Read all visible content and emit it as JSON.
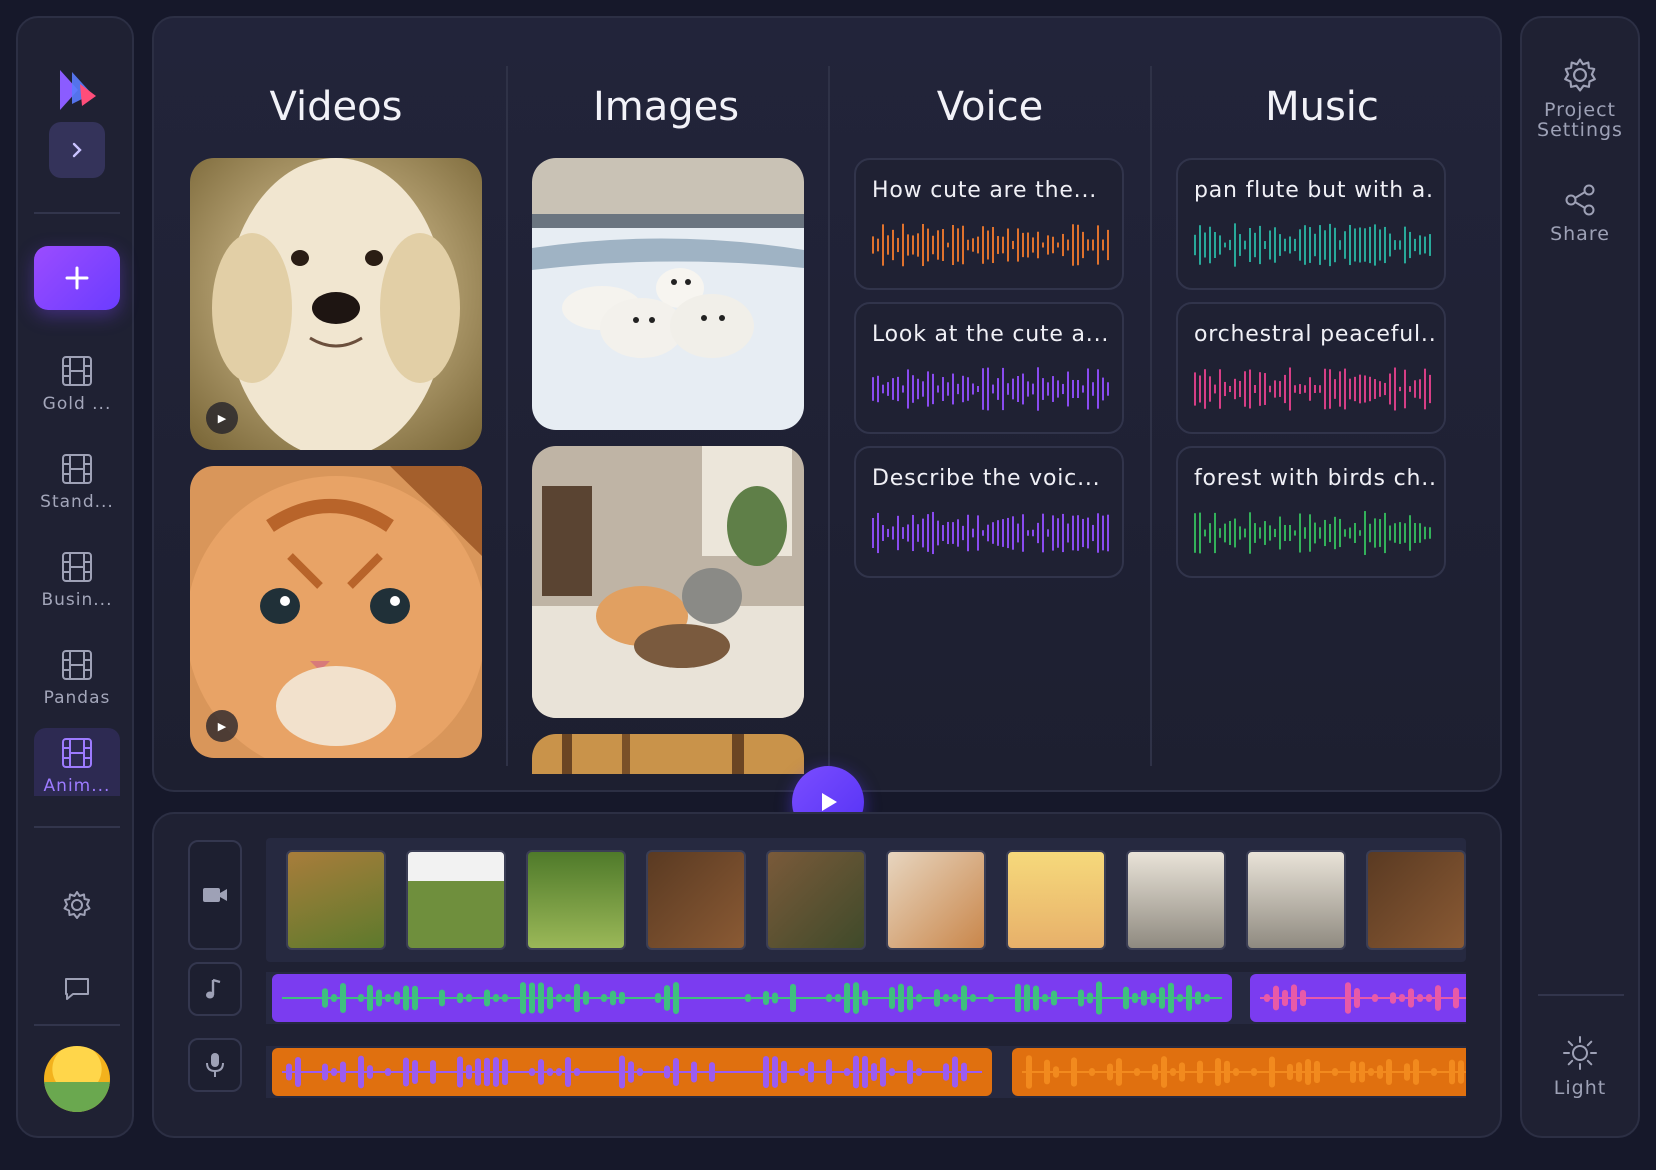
{
  "sidebar": {
    "expand_icon": "chevron-right-icon",
    "new_label": "+",
    "projects": [
      {
        "label": "Gold ..."
      },
      {
        "label": "Stand..."
      },
      {
        "label": "Busin..."
      },
      {
        "label": "Pandas"
      },
      {
        "label": "Anim..."
      }
    ],
    "settings_icon": "gear-icon",
    "feedback_icon": "chat-bubble-icon"
  },
  "library": {
    "columns": [
      {
        "title": "Videos"
      },
      {
        "title": "Images"
      },
      {
        "title": "Voice"
      },
      {
        "title": "Music"
      }
    ],
    "voice_cards": [
      {
        "text": "How cute are the...",
        "color": "#e0722d"
      },
      {
        "text": "Look at the cute a...",
        "color": "#8a4bf0"
      },
      {
        "text": "Describe the voic...",
        "color": "#8a4bf0"
      }
    ],
    "music_cards": [
      {
        "text": "pan flute but with a...",
        "color": "#28a99a"
      },
      {
        "text": "orchestral peaceful...",
        "color": "#d63e86"
      },
      {
        "text": "forest with birds ch...",
        "color": "#33b15a"
      }
    ]
  },
  "right_rail": {
    "project_settings_label_1": "Project",
    "project_settings_label_2": "Settings",
    "share_label": "Share",
    "theme_label": "Light"
  },
  "colors": {
    "accent": "#7a4dff",
    "voice_track": "#7b3cf0",
    "music_track": "#e0700f"
  }
}
